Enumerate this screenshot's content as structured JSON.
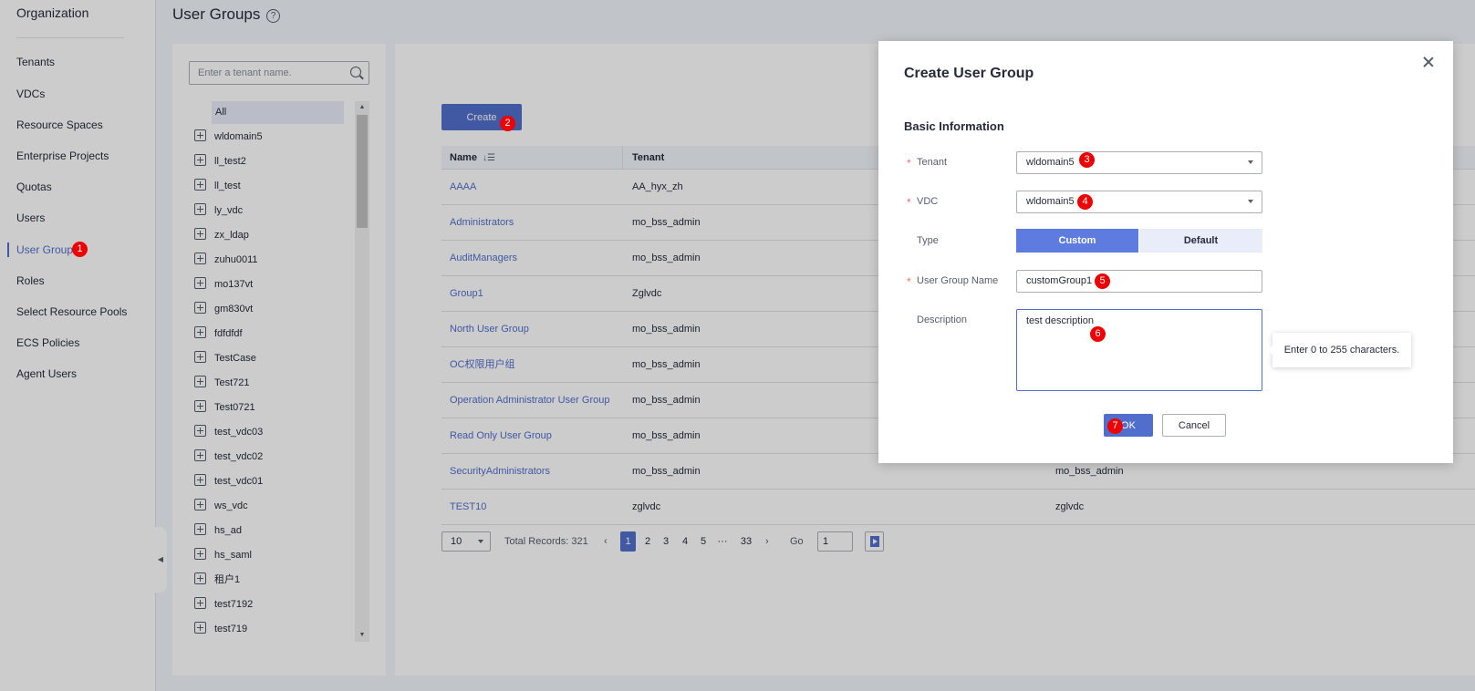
{
  "nav": {
    "title": "Organization",
    "items": [
      "Tenants",
      "VDCs",
      "Resource Spaces",
      "Enterprise Projects",
      "Quotas",
      "Users",
      "User Groups",
      "Roles",
      "Select Resource Pools",
      "ECS Policies",
      "Agent Users"
    ],
    "active": "User Groups"
  },
  "page": {
    "title": "User Groups",
    "help_icon": "?"
  },
  "tree": {
    "search_placeholder": "Enter a tenant name.",
    "all_label": "All",
    "items": [
      "wldomain5",
      "ll_test2",
      "ll_test",
      "ly_vdc",
      "zx_ldap",
      "zuhu0011",
      "mo137vt",
      "gm830vt",
      "fdfdfdf",
      "TestCase",
      "Test721",
      "Test0721",
      "test_vdc03",
      "test_vdc02",
      "test_vdc01",
      "ws_vdc",
      "hs_ad",
      "hs_saml",
      "租户1",
      "test7192",
      "test719"
    ]
  },
  "toolbar": {
    "create_label": "Create"
  },
  "table": {
    "headers": [
      "Name",
      "Tenant"
    ],
    "rows": [
      {
        "name": "AAAA",
        "tenant": "AA_hyx_zh",
        "extra": ""
      },
      {
        "name": "Administrators",
        "tenant": "mo_bss_admin",
        "extra": ""
      },
      {
        "name": "AuditManagers",
        "tenant": "mo_bss_admin",
        "extra": ""
      },
      {
        "name": "Group1",
        "tenant": "Zglvdc",
        "extra": ""
      },
      {
        "name": "North User Group",
        "tenant": "mo_bss_admin",
        "extra": ""
      },
      {
        "name": "OC权限用户组",
        "tenant": "mo_bss_admin",
        "extra": ""
      },
      {
        "name": "Operation Administrator User Group",
        "tenant": "mo_bss_admin",
        "extra": ""
      },
      {
        "name": "Read Only User Group",
        "tenant": "mo_bss_admin",
        "extra": ""
      },
      {
        "name": "SecurityAdministrators",
        "tenant": "mo_bss_admin",
        "extra": "mo_bss_admin"
      },
      {
        "name": "TEST10",
        "tenant": "zglvdc",
        "extra": "zglvdc"
      }
    ]
  },
  "pagination": {
    "page_size": "10",
    "total": "Total Records: 321",
    "pages": [
      "1",
      "2",
      "3",
      "4",
      "5",
      "···",
      "33"
    ],
    "current": "1",
    "go_label": "Go",
    "go_value": "1"
  },
  "modal": {
    "title": "Create User Group",
    "section": "Basic Information",
    "tenant_label": "Tenant",
    "tenant_value": "wldomain5",
    "vdc_label": "VDC",
    "vdc_value": "wldomain5",
    "type_label": "Type",
    "type_options": [
      "Custom",
      "Default"
    ],
    "type_selected": "Custom",
    "name_label": "User Group Name",
    "name_value": "customGroup1",
    "desc_label": "Description",
    "desc_value": "test description",
    "tooltip": "Enter 0 to 255 characters.",
    "ok_label": "OK",
    "cancel_label": "Cancel",
    "required_mark": "*"
  },
  "steps": [
    "1",
    "2",
    "3",
    "4",
    "5",
    "6",
    "7"
  ],
  "colors": {
    "accent": "#526ecc",
    "badge": "#ee0000"
  }
}
